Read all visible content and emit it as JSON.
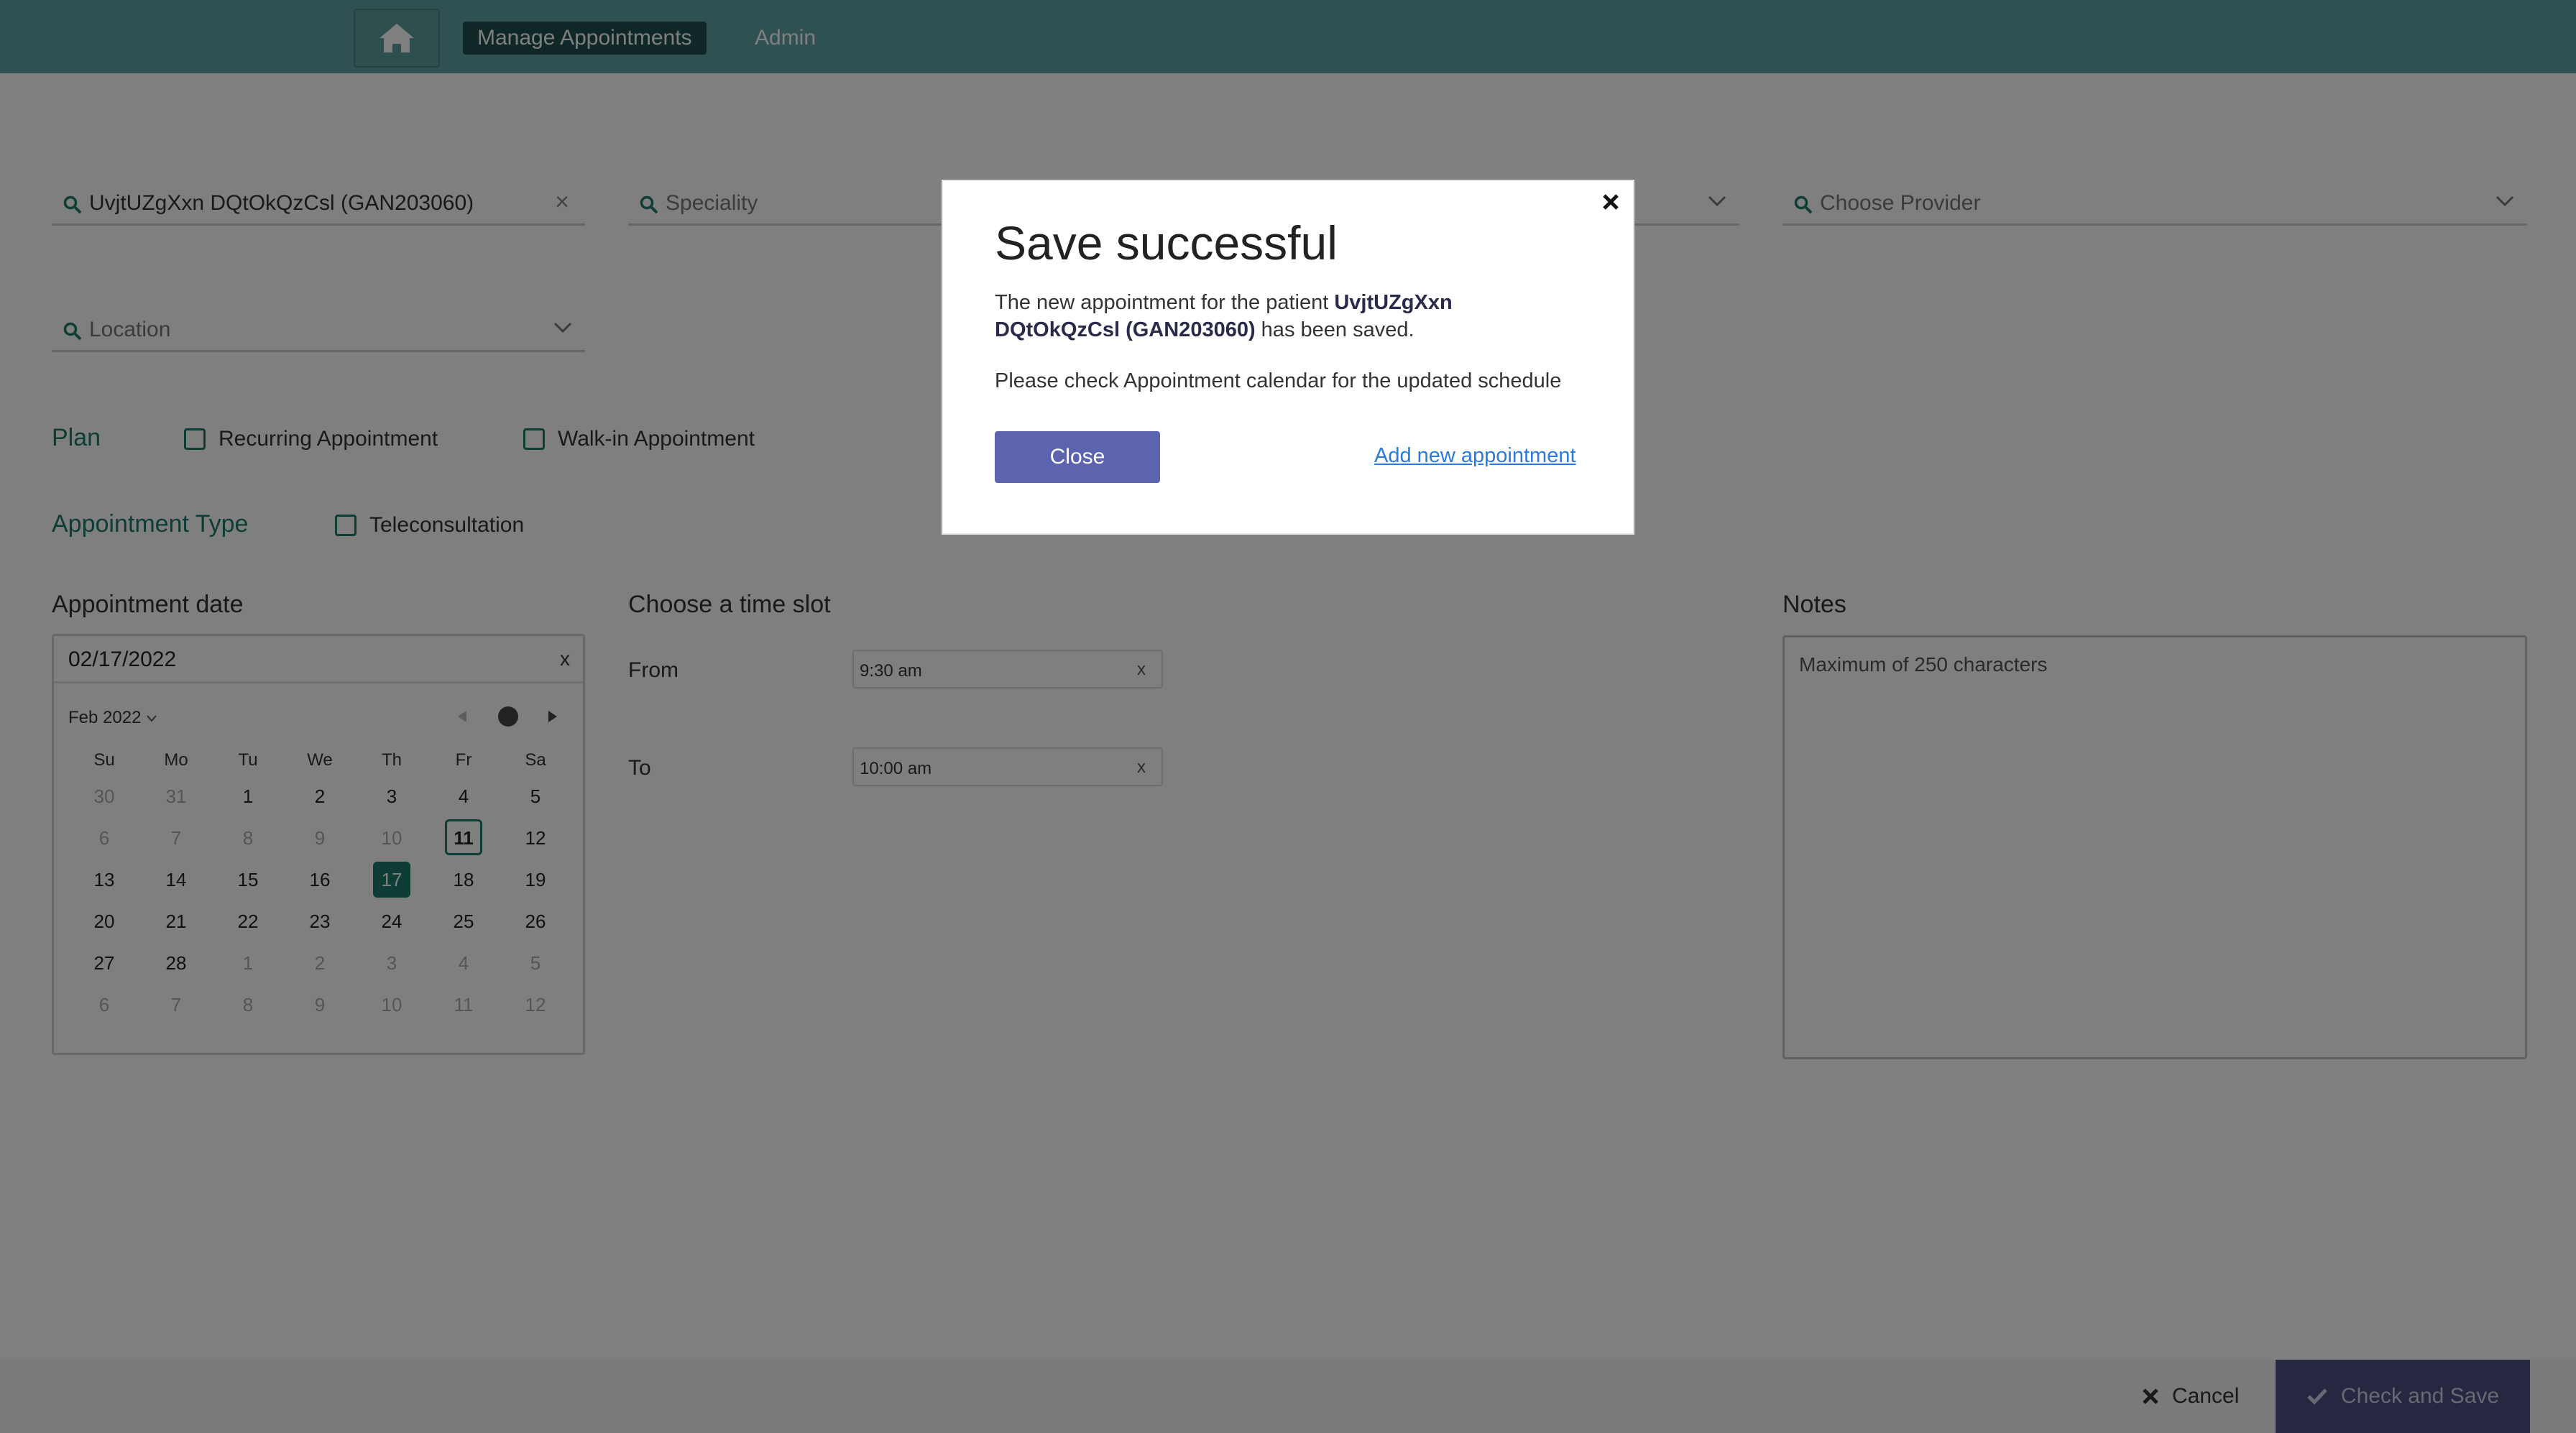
{
  "header": {
    "nav": [
      "Manage Appointments",
      "Admin"
    ]
  },
  "filters": {
    "patient_value": "UvjtUZgXxn DQtOkQzCsl (GAN203060)",
    "clear": "×",
    "speciality_placeholder": "Speciality",
    "provider_placeholder": "Choose Provider",
    "location_placeholder": "Location"
  },
  "plan": {
    "label": "Plan",
    "recurring": "Recurring Appointment",
    "walkin": "Walk-in Appointment"
  },
  "appt_type": {
    "label": "Appointment Type",
    "tele": "Teleconsultation"
  },
  "date": {
    "heading": "Appointment date",
    "value": "02/17/2022",
    "clear": "x",
    "month": "Feb 2022",
    "weekdays": [
      "Su",
      "Mo",
      "Tu",
      "We",
      "Th",
      "Fr",
      "Sa"
    ],
    "weeks": [
      [
        "30",
        "31",
        "1",
        "2",
        "3",
        "4",
        "5"
      ],
      [
        "6",
        "7",
        "8",
        "9",
        "10",
        "11",
        "12"
      ],
      [
        "13",
        "14",
        "15",
        "16",
        "17",
        "18",
        "19"
      ],
      [
        "20",
        "21",
        "22",
        "23",
        "24",
        "25",
        "26"
      ],
      [
        "27",
        "28",
        "1",
        "2",
        "3",
        "4",
        "5"
      ],
      [
        "6",
        "7",
        "8",
        "9",
        "10",
        "11",
        "12"
      ]
    ],
    "today": "11",
    "selected": "17"
  },
  "timeslot": {
    "heading": "Choose a time slot",
    "from_label": "From",
    "from_value": "9:30 am",
    "to_label": "To",
    "to_value": "10:00 am",
    "clear": "x"
  },
  "notes": {
    "heading": "Notes",
    "placeholder": "Maximum of 250 characters"
  },
  "footer": {
    "cancel": "Cancel",
    "save": "Check and Save"
  },
  "modal": {
    "title": "Save successful",
    "text_prefix": "The new appointment for the patient ",
    "patient": "UvjtUZgXxn DQtOkQzCsl (GAN203060)",
    "text_suffix": " has been saved.",
    "text2": "Please check Appointment calendar for the updated schedule",
    "close": "Close",
    "add_new": "Add new appointment"
  },
  "colors": {
    "header": "#60a3a3",
    "accent": "#1d7a6b",
    "primary_button": "#5c64b0",
    "link": "#2a7be0"
  }
}
